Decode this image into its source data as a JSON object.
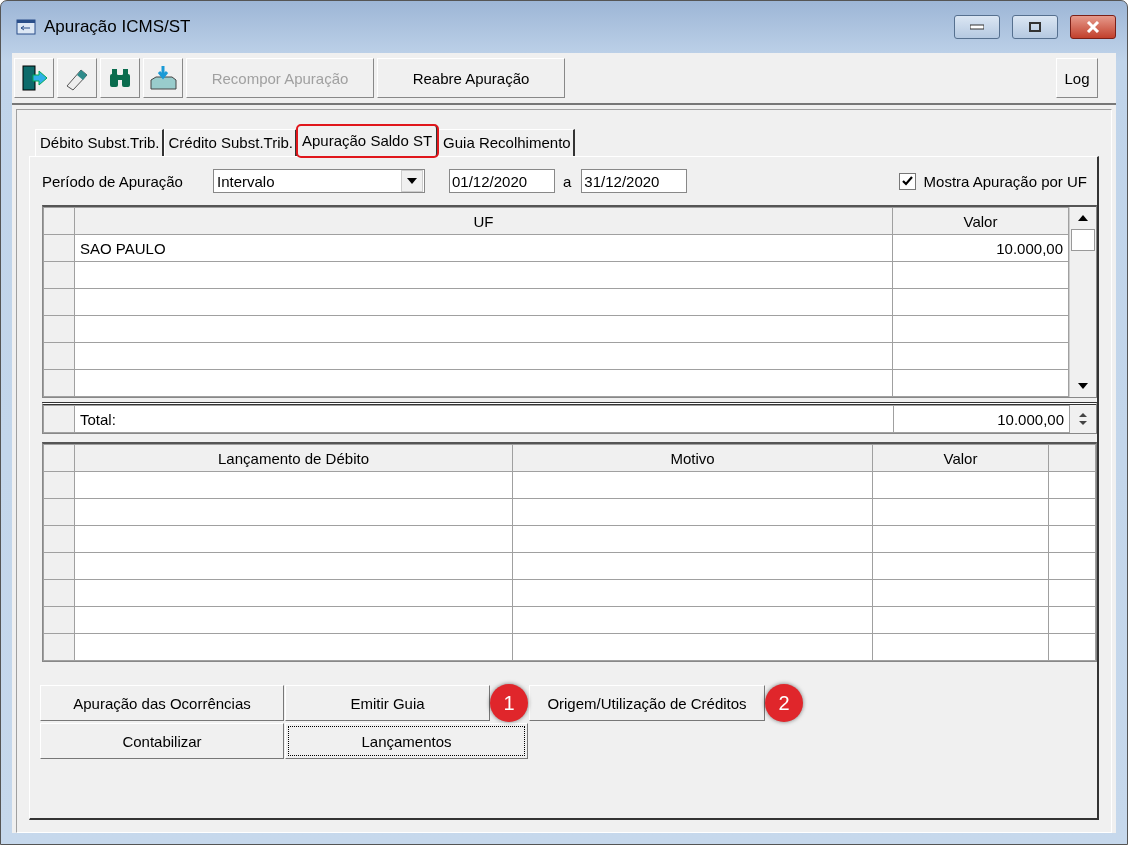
{
  "window": {
    "title": "Apuração ICMS/ST"
  },
  "toolbar": {
    "icon_buttons": [
      {
        "kind": "exit"
      },
      {
        "kind": "eraser"
      },
      {
        "kind": "binoculars"
      },
      {
        "kind": "import"
      }
    ],
    "buttons": [
      {
        "label": "Recompor Apuração",
        "disabled": true
      },
      {
        "label": "Reabre Apuração",
        "disabled": false
      }
    ],
    "log_button": "Log"
  },
  "tabs": [
    {
      "label": "Débito Subst.Trib.",
      "selected": false,
      "highlighted": false
    },
    {
      "label": "Crédito Subst.Trib.",
      "selected": false,
      "highlighted": false
    },
    {
      "label": "Apuração Saldo ST",
      "selected": true,
      "highlighted": true
    },
    {
      "label": "Guia Recolhimento",
      "selected": false,
      "highlighted": false
    }
  ],
  "period": {
    "label": "Período de  Apuração",
    "type": "Intervalo",
    "from": "01/12/2020",
    "separator": "a",
    "to": "31/12/2020"
  },
  "show_by_uf": {
    "label": "Mostra Apuração por UF",
    "checked": true
  },
  "uf_table": {
    "columns": [
      "UF",
      "Valor"
    ],
    "rows": [
      {
        "uf": "SAO PAULO",
        "valor": "10.000,00"
      }
    ],
    "total_label": "Total:",
    "total_value": "10.000,00"
  },
  "debit_table": {
    "columns": [
      "Lançamento de Débito",
      "Motivo",
      "Valor"
    ]
  },
  "actions": [
    {
      "label": "Apuração das Ocorrências",
      "focused": false
    },
    {
      "label": "Emitir Guia",
      "focused": false,
      "callout": "1"
    },
    {
      "label": "Origem/Utilização de Créditos",
      "focused": false,
      "callout": "2"
    },
    {
      "label": "Contabilizar",
      "focused": false
    },
    {
      "label": "Lançamentos",
      "focused": true
    }
  ]
}
